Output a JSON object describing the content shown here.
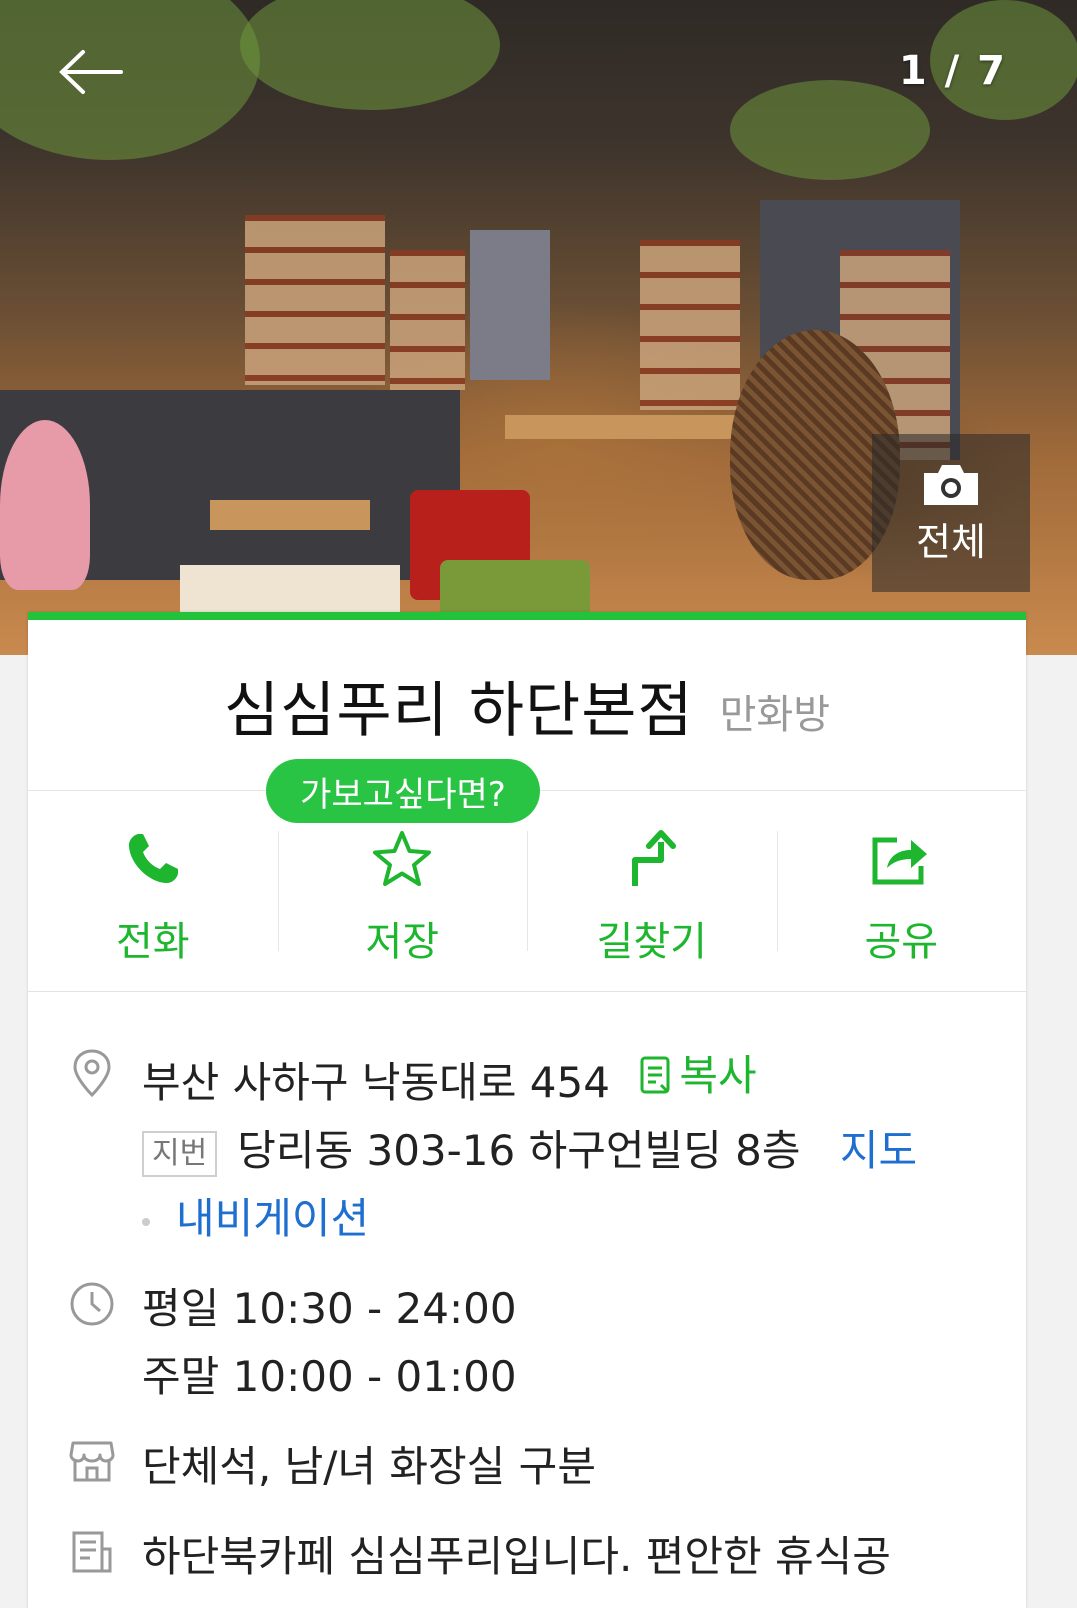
{
  "header": {
    "photo_counter": "1 / 7",
    "all_photos_label": "전체"
  },
  "place": {
    "name": "심심푸리 하단본점",
    "category": "만화방"
  },
  "tooltip": "가보고싶다면?",
  "actions": [
    {
      "label": "전화",
      "icon": "phone-icon"
    },
    {
      "label": "저장",
      "icon": "star-icon"
    },
    {
      "label": "길찾기",
      "icon": "directions-icon"
    },
    {
      "label": "공유",
      "icon": "share-icon"
    }
  ],
  "address": {
    "road": "부산 사하구 낙동대로 454",
    "copy_label": "복사",
    "jibun_badge": "지번",
    "jibun": "당리동 303-16 하구언빌딩 8층",
    "map_label": "지도",
    "navigation_label": "내비게이션"
  },
  "hours": {
    "weekday": "평일 10:30 - 24:00",
    "weekend": "주말 10:00 - 01:00"
  },
  "facilities": "단체석, 남/녀 화장실 구분",
  "description": "하단북카페 심심푸리입니다. 편안한 휴식공",
  "colors": {
    "accent_green": "#22c33a",
    "link_blue": "#1e6fd0"
  }
}
